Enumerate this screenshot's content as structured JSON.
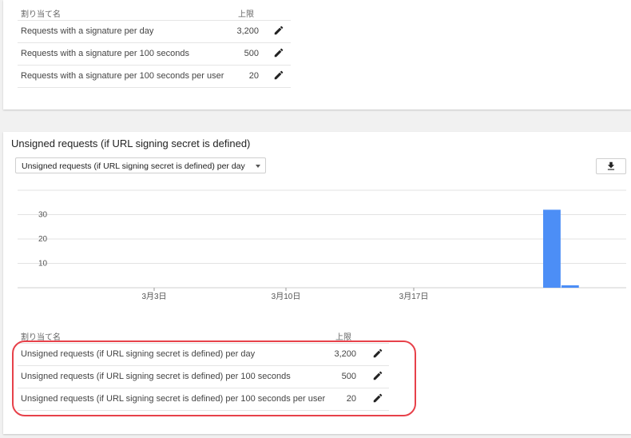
{
  "signed_table": {
    "header_name": "割り当て名",
    "header_limit": "上限",
    "rows": [
      {
        "name": "Requests with a signature per day",
        "limit": "3,200"
      },
      {
        "name": "Requests with a signature per 100 seconds",
        "limit": "500"
      },
      {
        "name": "Requests with a signature per 100 seconds per user",
        "limit": "20"
      }
    ]
  },
  "unsigned_section": {
    "title": "Unsigned requests (if URL signing secret is defined)",
    "metric_selected": "Unsigned requests (if URL signing secret is defined) per day",
    "download_icon": "download-icon"
  },
  "chart_data": {
    "type": "bar",
    "title": "",
    "xlabel": "",
    "ylabel": "",
    "x_ticks": [
      "3月3日",
      "3月10日",
      "3月17日"
    ],
    "y_ticks": [
      10,
      20,
      30
    ],
    "ylim": [
      0,
      40
    ],
    "grid": true,
    "series": [
      {
        "values": [
          {
            "day_after_3月17日": 7,
            "value": 32
          },
          {
            "day_after_3月17日": 8,
            "value": 1
          }
        ]
      }
    ],
    "bar_color": "#4c8ef6"
  },
  "unsigned_table": {
    "header_name": "割り当て名",
    "header_limit": "上限",
    "rows": [
      {
        "name": "Unsigned requests (if URL signing secret is defined) per day",
        "limit": "3,200"
      },
      {
        "name": "Unsigned requests (if URL signing secret is defined) per 100 seconds",
        "limit": "500"
      },
      {
        "name": "Unsigned requests (if URL signing secret is defined) per 100 seconds per user",
        "limit": "20"
      }
    ]
  },
  "highlight_color": "#e7414a"
}
